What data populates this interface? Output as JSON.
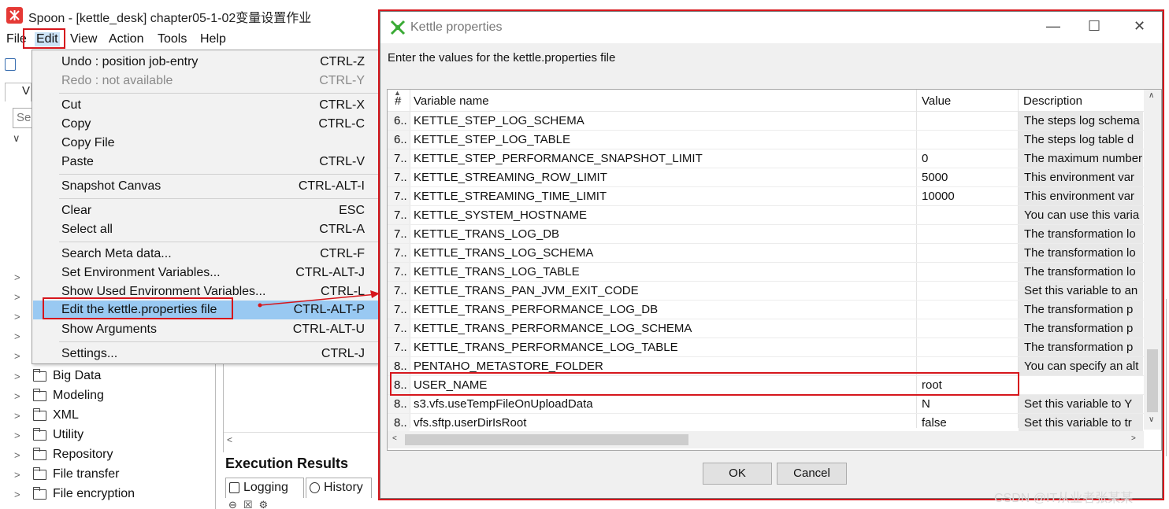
{
  "window": {
    "title": "Spoon - [kettle_desk] chapter05-1-02变量设置作业"
  },
  "menubar": [
    "File",
    "Edit",
    "View",
    "Action",
    "Tools",
    "Help"
  ],
  "left_panel": {
    "tab_label": "V",
    "search_placeholder": "Se",
    "tree_items": [
      "Big Data",
      "Modeling",
      "XML",
      "Utility",
      "Repository",
      "File transfer",
      "File encryption"
    ]
  },
  "execution": {
    "title": "Execution Results",
    "tabs": [
      "Logging",
      "History"
    ]
  },
  "edit_menu": {
    "items": [
      {
        "label": "Undo : position job-entry",
        "accel": "CTRL-Z",
        "disabled": false
      },
      {
        "label": "Redo : not available",
        "accel": "CTRL-Y",
        "disabled": true
      },
      {
        "label": "Cut",
        "accel": "CTRL-X",
        "disabled": false
      },
      {
        "label": "Copy",
        "accel": "CTRL-C",
        "disabled": false
      },
      {
        "label": "Copy File",
        "accel": "",
        "disabled": false
      },
      {
        "label": "Paste",
        "accel": "CTRL-V",
        "disabled": false
      },
      {
        "label": "Snapshot Canvas",
        "accel": "CTRL-ALT-I",
        "disabled": false
      },
      {
        "label": "Clear",
        "accel": "ESC",
        "disabled": false
      },
      {
        "label": "Select all",
        "accel": "CTRL-A",
        "disabled": false
      },
      {
        "label": "Search Meta data...",
        "accel": "CTRL-F",
        "disabled": false
      },
      {
        "label": "Set Environment Variables...",
        "accel": "CTRL-ALT-J",
        "disabled": false
      },
      {
        "label": "Show Used Environment Variables...",
        "accel": "CTRL-L",
        "disabled": false
      },
      {
        "label": "Edit the kettle.properties file",
        "accel": "CTRL-ALT-P",
        "disabled": false,
        "selected": true
      },
      {
        "label": "Show Arguments",
        "accel": "CTRL-ALT-U",
        "disabled": false
      },
      {
        "label": "Settings...",
        "accel": "CTRL-J",
        "disabled": false
      }
    ]
  },
  "dialog": {
    "title": "Kettle properties",
    "description": "Enter the values for the kettle.properties file",
    "columns": [
      "#",
      "Variable name",
      "Value",
      "Description"
    ],
    "rows": [
      {
        "num": "6..",
        "name": "KETTLE_STEP_LOG_SCHEMA",
        "value": "",
        "desc": "The steps log schema"
      },
      {
        "num": "6..",
        "name": "KETTLE_STEP_LOG_TABLE",
        "value": "",
        "desc": "The steps log table d"
      },
      {
        "num": "7..",
        "name": "KETTLE_STEP_PERFORMANCE_SNAPSHOT_LIMIT",
        "value": "0",
        "desc": "The maximum number"
      },
      {
        "num": "7..",
        "name": "KETTLE_STREAMING_ROW_LIMIT",
        "value": "5000",
        "desc": "This environment var"
      },
      {
        "num": "7..",
        "name": "KETTLE_STREAMING_TIME_LIMIT",
        "value": "10000",
        "desc": "This environment var"
      },
      {
        "num": "7..",
        "name": "KETTLE_SYSTEM_HOSTNAME",
        "value": "",
        "desc": "You can use this varia"
      },
      {
        "num": "7..",
        "name": "KETTLE_TRANS_LOG_DB",
        "value": "",
        "desc": "The transformation lo"
      },
      {
        "num": "7..",
        "name": "KETTLE_TRANS_LOG_SCHEMA",
        "value": "",
        "desc": "The transformation lo"
      },
      {
        "num": "7..",
        "name": "KETTLE_TRANS_LOG_TABLE",
        "value": "",
        "desc": "The transformation lo"
      },
      {
        "num": "7..",
        "name": "KETTLE_TRANS_PAN_JVM_EXIT_CODE",
        "value": "",
        "desc": "Set this variable to an"
      },
      {
        "num": "7..",
        "name": "KETTLE_TRANS_PERFORMANCE_LOG_DB",
        "value": "",
        "desc": "The transformation p"
      },
      {
        "num": "7..",
        "name": "KETTLE_TRANS_PERFORMANCE_LOG_SCHEMA",
        "value": "",
        "desc": "The transformation p"
      },
      {
        "num": "7..",
        "name": "KETTLE_TRANS_PERFORMANCE_LOG_TABLE",
        "value": "",
        "desc": "The transformation p"
      },
      {
        "num": "8..",
        "name": "PENTAHO_METASTORE_FOLDER",
        "value": "",
        "desc": "You can specify an alt"
      },
      {
        "num": "8..",
        "name": "USER_NAME",
        "value": "root",
        "desc": ""
      },
      {
        "num": "8..",
        "name": "s3.vfs.useTempFileOnUploadData",
        "value": "N",
        "desc": "Set this variable to Y"
      },
      {
        "num": "8..",
        "name": "vfs.sftp.userDirIsRoot",
        "value": "false",
        "desc": "Set this variable to tr"
      }
    ],
    "ok_label": "OK",
    "cancel_label": "Cancel"
  },
  "watermark": "CSDN @IT从业者张某某",
  "colors": {
    "annotation_red": "#d6161c",
    "menu_selected": "#99c9f2",
    "kettle_green": "#3aaa35"
  }
}
